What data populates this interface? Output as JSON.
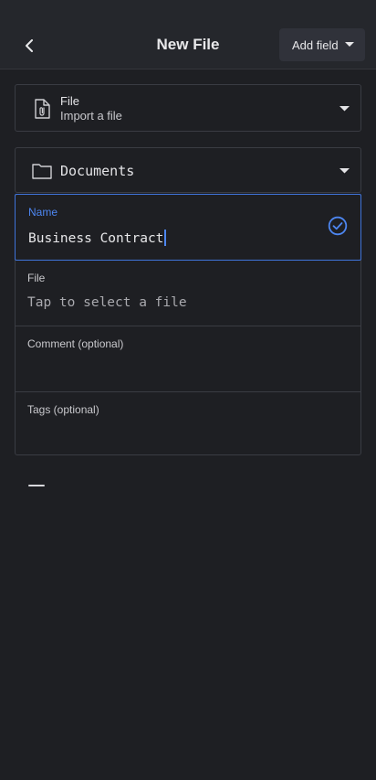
{
  "header": {
    "title": "New File",
    "add_field_label": "Add field",
    "back_icon": "chevron-left-icon"
  },
  "type_selector": {
    "title": "File",
    "subtitle": "Import a file",
    "icon": "file-attachment-icon"
  },
  "folder_selector": {
    "label": "Documents",
    "icon": "folder-icon"
  },
  "form": {
    "name": {
      "label": "Name",
      "value": "Business Contract"
    },
    "file": {
      "label": "File",
      "placeholder": "Tap to select a file"
    },
    "comment": {
      "label": "Comment (optional)",
      "value": ""
    },
    "tags": {
      "label": "Tags (optional)",
      "value": ""
    }
  },
  "colors": {
    "background": "#1e1f23",
    "header": "#25272c",
    "accent": "#4d86f0",
    "border": "#3a3c43"
  }
}
